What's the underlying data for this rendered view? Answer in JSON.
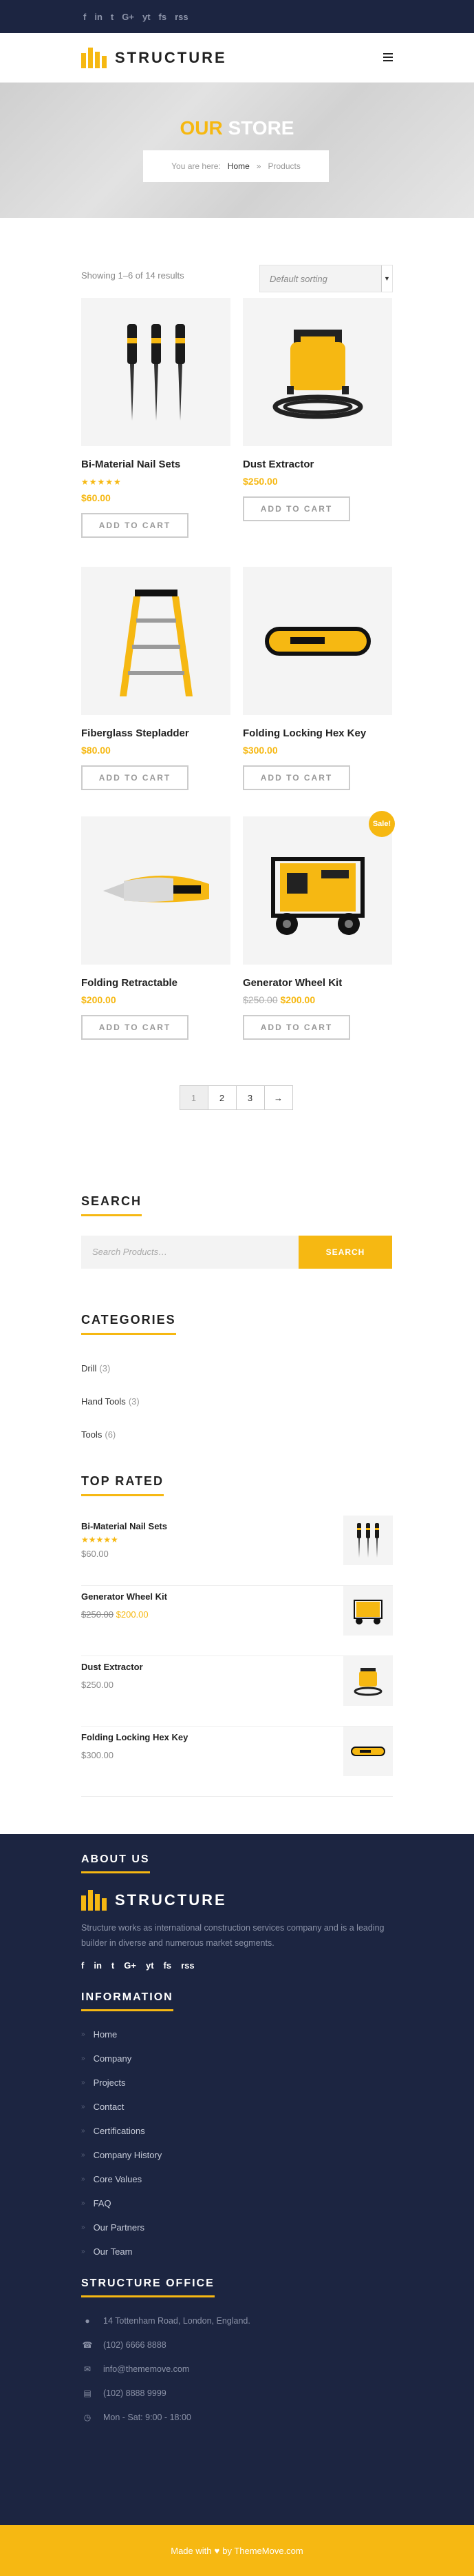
{
  "topbar": {
    "social": [
      "f",
      "in",
      "t",
      "G+",
      "yt",
      "fs",
      "rss"
    ]
  },
  "header": {
    "logo": "STRUCTURE"
  },
  "hero": {
    "title_accent": "OUR",
    "title_rest": "STORE",
    "breadcrumb_prefix": "You are here:",
    "breadcrumb_home": "Home",
    "breadcrumb_sep": "»",
    "breadcrumb_current": "Products"
  },
  "shop": {
    "result_count": "Showing 1–6 of 14 results",
    "sorting": "Default sorting",
    "products": [
      {
        "name": "Bi-Material Nail Sets",
        "stars": "★★★★★",
        "price": "$60.00",
        "old_price": "",
        "button": "ADD TO CART"
      },
      {
        "name": "Dust Extractor",
        "stars": "",
        "price": "$250.00",
        "old_price": "",
        "button": "ADD TO CART"
      },
      {
        "name": "Fiberglass Stepladder",
        "stars": "",
        "price": "$80.00",
        "old_price": "",
        "button": "ADD TO CART"
      },
      {
        "name": "Folding Locking Hex Key",
        "stars": "",
        "price": "$300.00",
        "old_price": "",
        "button": "ADD TO CART"
      },
      {
        "name": "Folding Retractable",
        "stars": "",
        "price": "$200.00",
        "old_price": "",
        "button": "ADD TO CART"
      },
      {
        "name": "Generator Wheel Kit",
        "stars": "",
        "price": "$200.00",
        "old_price": "$250.00",
        "button": "ADD TO CART",
        "badge": "Sale!"
      }
    ],
    "pagination": [
      "1",
      "2",
      "3",
      "→"
    ]
  },
  "sidebar": {
    "search_title": "SEARCH",
    "search_placeholder": "Search Products…",
    "search_button": "SEARCH",
    "categories_title": "CATEGORIES",
    "categories": [
      {
        "name": "Drill",
        "count": "(3)"
      },
      {
        "name": "Hand Tools",
        "count": "(3)"
      },
      {
        "name": "Tools",
        "count": "(6)"
      }
    ],
    "top_rated_title": "TOP RATED",
    "top_rated": [
      {
        "name": "Bi-Material Nail Sets",
        "stars": "★★★★★",
        "price": "$60.00",
        "old_price": ""
      },
      {
        "name": "Generator Wheel Kit",
        "stars": "",
        "price": "$200.00",
        "old_price": "$250.00"
      },
      {
        "name": "Dust Extractor",
        "stars": "",
        "price": "$250.00",
        "old_price": ""
      },
      {
        "name": "Folding Locking Hex Key",
        "stars": "",
        "price": "$300.00",
        "old_price": ""
      }
    ]
  },
  "footer": {
    "about_title": "ABOUT US",
    "logo": "STRUCTURE",
    "about_text": "Structure works as international construction services company and is a leading builder in diverse and numerous market segments.",
    "social": [
      "f",
      "in",
      "t",
      "G+",
      "yt",
      "fs",
      "rss"
    ],
    "info_title": "INFORMATION",
    "links": [
      "Home",
      "Company",
      "Projects",
      "Contact",
      "Certifications",
      "Company History",
      "Core Values",
      "FAQ",
      "Our Partners",
      "Our Team"
    ],
    "office_title": "STRUCTURE OFFICE",
    "contacts": [
      {
        "icon": "map-pin-icon",
        "text": "14 Tottenham Road, London, England."
      },
      {
        "icon": "phone-icon",
        "text": "(102) 6666 8888"
      },
      {
        "icon": "envelope-icon",
        "text": "info@thememove.com"
      },
      {
        "icon": "fax-icon",
        "text": "(102) 8888 9999"
      },
      {
        "icon": "clock-icon",
        "text": "Mon - Sat: 9:00 - 18:00"
      }
    ]
  },
  "copyright": {
    "made_with": "Made with",
    "by": "by ThemeMove.com"
  },
  "colors": {
    "accent": "#f6b812",
    "navy": "#1c2541"
  }
}
